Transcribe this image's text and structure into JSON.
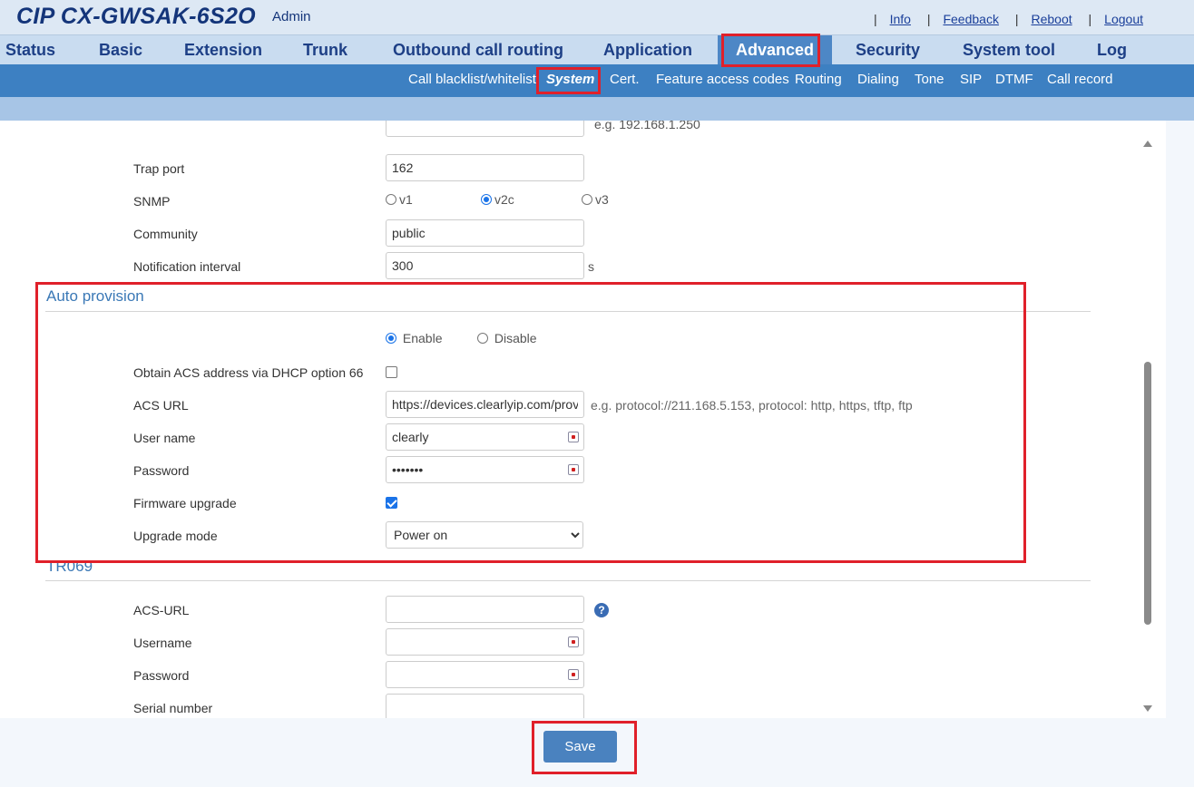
{
  "header": {
    "brand": "CIP CX-GWSAK-6S2O",
    "user": "Admin",
    "links": [
      "Info",
      "Feedback",
      "Reboot",
      "Logout"
    ]
  },
  "main_nav": {
    "items": [
      "Status",
      "Basic",
      "Extension",
      "Trunk",
      "Outbound call routing",
      "Application",
      "Advanced",
      "Security",
      "System tool",
      "Log"
    ],
    "active": "Advanced"
  },
  "sub_nav": {
    "items": [
      "Call blacklist/whitelist",
      "System",
      "Cert.",
      "Feature access codes",
      "Routing",
      "Dialing",
      "Tone",
      "SIP",
      "DTMF",
      "Call record"
    ],
    "active": "System"
  },
  "snmp": {
    "server_hint": "e.g. 192.168.1.250",
    "trap_port_label": "Trap port",
    "trap_port_value": "162",
    "snmp_label": "SNMP",
    "versions": [
      "v1",
      "v2c",
      "v3"
    ],
    "selected_version": "v2c",
    "community_label": "Community",
    "community_value": "public",
    "notification_label": "Notification interval",
    "notification_value": "300",
    "notification_unit": "s"
  },
  "auto_provision": {
    "title": "Auto provision",
    "enable_label": "Enable",
    "disable_label": "Disable",
    "enabled": true,
    "dhcp_label": "Obtain ACS address via DHCP option 66",
    "dhcp_checked": false,
    "acs_url_label": "ACS URL",
    "acs_url_value": "https://devices.clearlyip.com/provi",
    "acs_url_hint": "e.g. protocol://211.168.5.153, protocol: http, https, tftp, ftp",
    "username_label": "User name",
    "username_value": "clearly",
    "password_label": "Password",
    "password_value": "•••••••",
    "firmware_label": "Firmware upgrade",
    "firmware_checked": true,
    "upgrade_mode_label": "Upgrade mode",
    "upgrade_mode_value": "Power on"
  },
  "tr069": {
    "title": "TR069",
    "acs_url_label": "ACS-URL",
    "acs_url_value": "",
    "username_label": "Username",
    "username_value": "",
    "password_label": "Password",
    "password_value": "",
    "serial_label": "Serial number",
    "serial_value": ""
  },
  "actions": {
    "save_label": "Save"
  },
  "colors": {
    "nav_active": "#4d87c6",
    "subnav": "#3d80c2",
    "highlight": "#e0202a",
    "brand": "#14357a"
  }
}
